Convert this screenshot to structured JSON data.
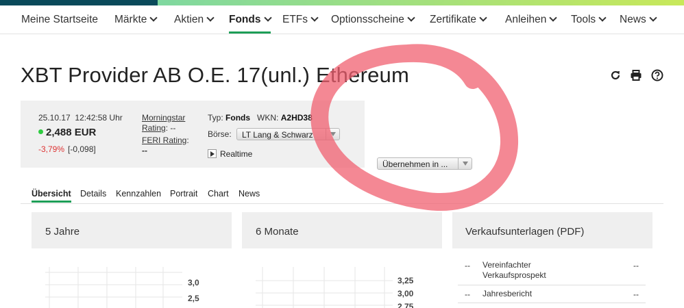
{
  "nav": {
    "items": [
      {
        "label": "Meine Startseite",
        "chevron": false
      },
      {
        "label": "Märkte",
        "chevron": true
      },
      {
        "label": "Aktien",
        "chevron": true
      },
      {
        "label": "Fonds",
        "chevron": true
      },
      {
        "label": "ETFs",
        "chevron": true
      },
      {
        "label": "Optionsscheine",
        "chevron": true
      },
      {
        "label": "Zertifikate",
        "chevron": true
      },
      {
        "label": "Anleihen",
        "chevron": true
      },
      {
        "label": "Tools",
        "chevron": true
      },
      {
        "label": "News",
        "chevron": true
      }
    ],
    "active": "Fonds"
  },
  "page_title": "XBT Provider AB O.E. 17(unl.) Ethereum",
  "toolbar": {
    "icons": [
      "refresh-icon",
      "print-icon",
      "help-icon"
    ]
  },
  "quote": {
    "date": "25.10.17",
    "time": "12:42:58 Uhr",
    "price": "2,488 EUR",
    "change_pct": "-3,79%",
    "change_abs": "[-0,098]",
    "morningstar_label_1": "Morningstar",
    "morningstar_label_2": "Rating",
    "morningstar_value": ": --",
    "feri_label": "FERI Rating",
    "feri_colon": ":",
    "feri_value": "--",
    "typ_label": "Typ:",
    "typ_value": "Fonds",
    "wkn_label": "WKN:",
    "wkn_value": "A2HD38",
    "boerse_label": "Börse:",
    "boerse_value": "LT Lang & Schwarz",
    "realtime_label": "Realtime",
    "uebernehmen_value": "Übernehmen in ..."
  },
  "tabs": [
    "Übersicht",
    "Details",
    "Kennzahlen",
    "Portrait",
    "Chart",
    "News"
  ],
  "panels": {
    "five_years": {
      "title": "5 Jahre",
      "ticks": [
        "3,0",
        "2,5"
      ]
    },
    "six_months": {
      "title": "6 Monate",
      "ticks": [
        "3,25",
        "3,00",
        "2,75"
      ]
    },
    "documents": {
      "title": "Verkaufsunterlagen (PDF)",
      "rows": [
        {
          "dash": "--",
          "name": "Vereinfachter Verkaufsprospekt",
          "value": "--"
        },
        {
          "dash": "--",
          "name": "Jahresbericht",
          "value": "--"
        }
      ]
    }
  },
  "colors": {
    "accent_green": "#1d9e57",
    "negative": "#dd3333",
    "annotation_circle": "#f06070"
  }
}
